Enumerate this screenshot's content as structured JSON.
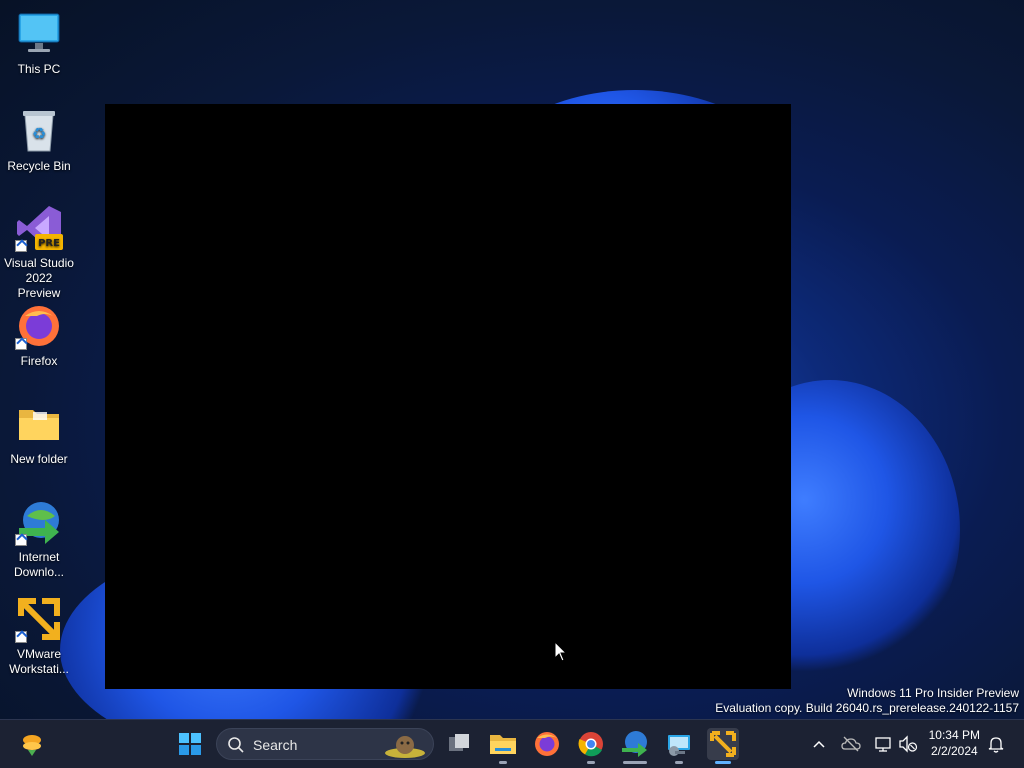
{
  "desktop": {
    "icons": [
      {
        "label_line1": "This PC",
        "label_line2": ""
      },
      {
        "label_line1": "Recycle Bin",
        "label_line2": ""
      },
      {
        "label_line1": "Visual Studio",
        "label_line2": "2022 Preview",
        "badge": "PRE"
      },
      {
        "label_line1": "Firefox",
        "label_line2": ""
      },
      {
        "label_line1": "New folder",
        "label_line2": ""
      },
      {
        "label_line1": "Internet",
        "label_line2": "Downlo..."
      },
      {
        "label_line1": "VMware",
        "label_line2": "Workstati..."
      }
    ]
  },
  "watermark": {
    "line1": "Windows 11 Pro Insider Preview",
    "line2": "Evaluation copy. Build 26040.rs_prerelease.240122-1157"
  },
  "taskbar": {
    "search_label": "Search",
    "time": "10:34 PM",
    "date": "2/2/2024"
  },
  "colors": {
    "accent": "#5fb2ff",
    "taskbar_bg": "#1c2233"
  }
}
